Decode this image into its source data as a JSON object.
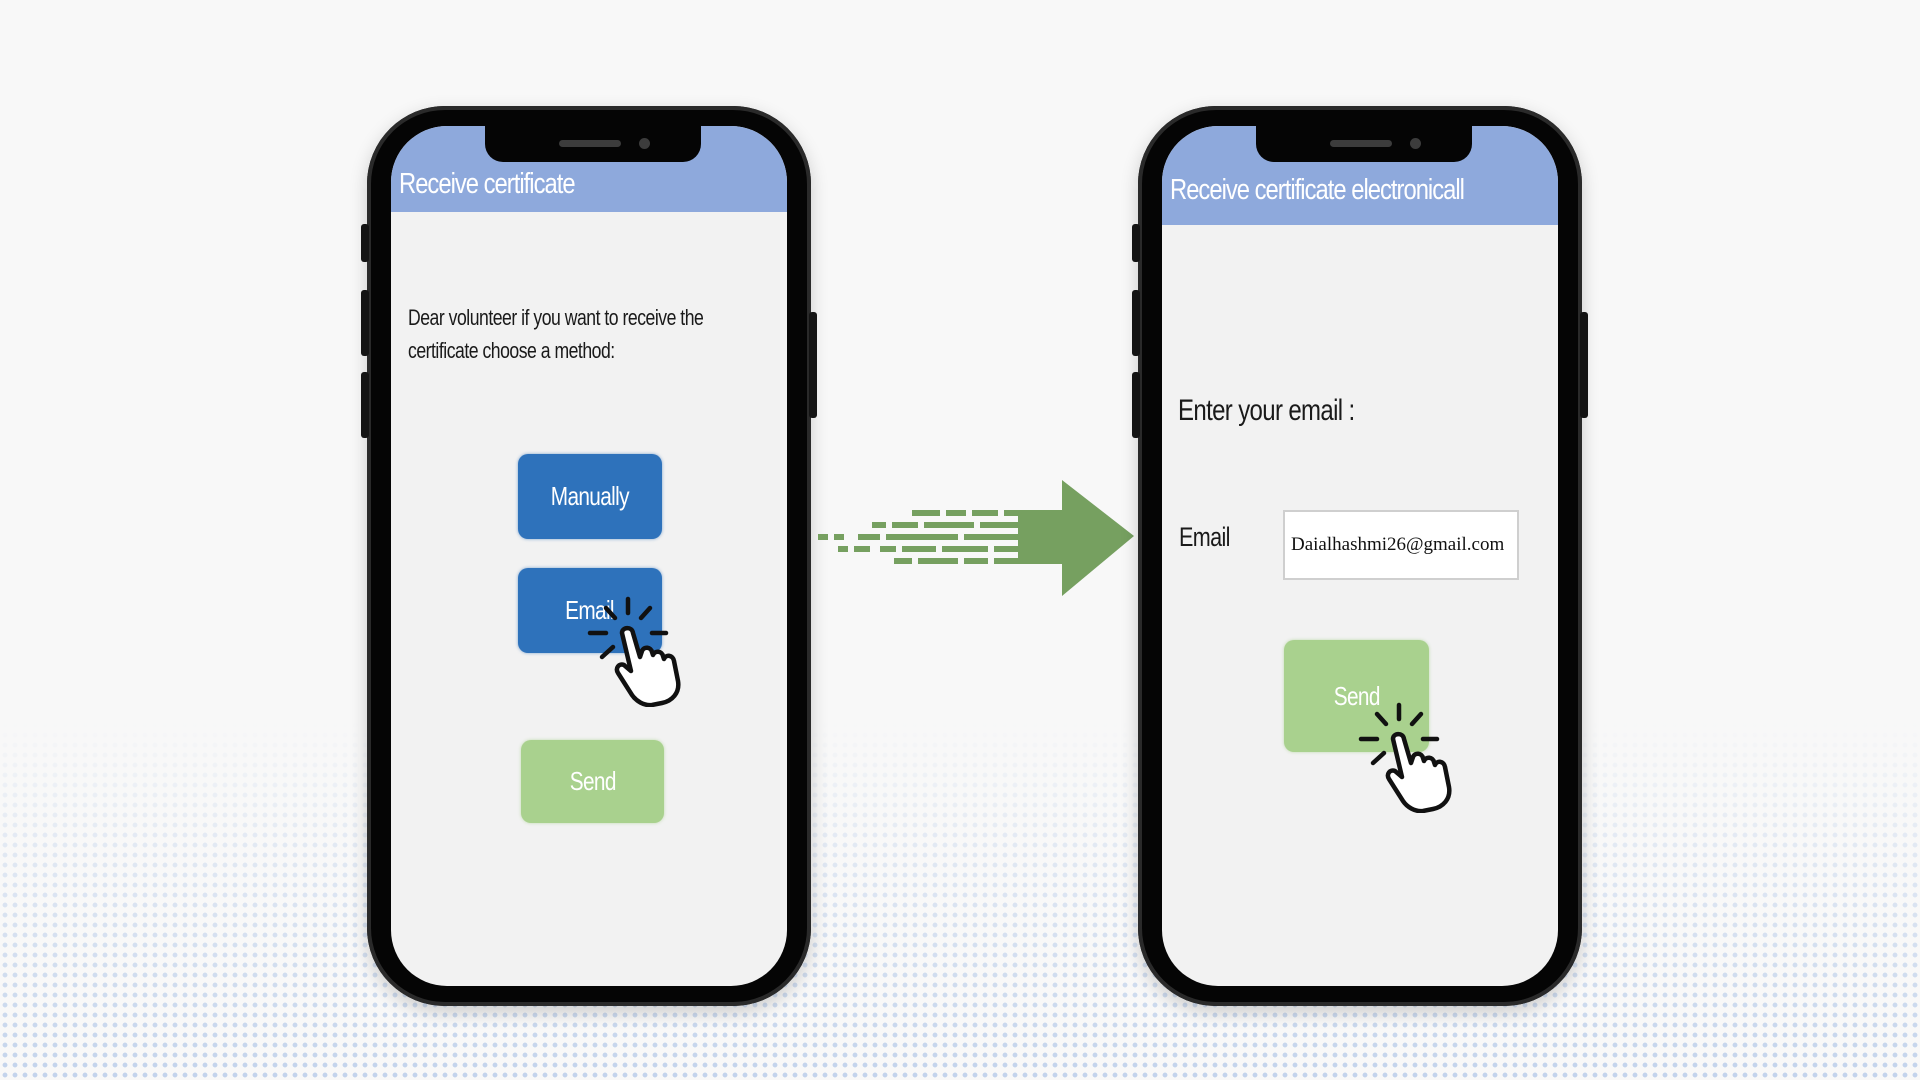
{
  "left_phone": {
    "header_title": "Receive certificate",
    "intro_line1": "Dear volunteer if you want to receive the",
    "intro_line2": "certificate choose a method:",
    "buttons": {
      "manually": "Manually",
      "email": "Email",
      "send": "Send"
    }
  },
  "right_phone": {
    "header_title": "Receive certificate electronicall",
    "prompt": "Enter your email :",
    "email_label": "Email",
    "email_value": "Daialhashmi26@gmail.com",
    "send": "Send"
  },
  "icons": {
    "pointer": "hand-pointer-click-icon",
    "transition": "arrow-right-icon"
  },
  "colors": {
    "header": "#8ea9dc",
    "primary_button": "#2e72bb",
    "send_button": "#a9d18e",
    "arrow": "#76a060"
  }
}
